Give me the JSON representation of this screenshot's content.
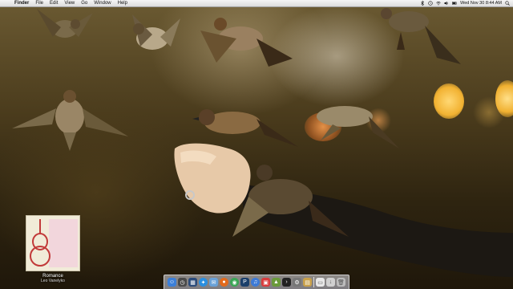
{
  "menubar": {
    "apple_symbol": "",
    "menus": [
      "Finder",
      "File",
      "Edit",
      "View",
      "Go",
      "Window",
      "Help"
    ],
    "clock": "Wed Nov 30  8:44 AM"
  },
  "desktop": {
    "file": {
      "name": "Romance",
      "artist": "Leo Vanelyko"
    }
  },
  "dock": {
    "items": [
      {
        "icon": "finder-icon",
        "color": "#3c7fd8"
      },
      {
        "icon": "dashboard-icon",
        "color": "#4a4a4a"
      },
      {
        "icon": "mission-control-icon",
        "color": "#2b4b7a"
      },
      {
        "icon": "safari-icon",
        "color": "#2a8fe0"
      },
      {
        "icon": "mail-icon",
        "color": "#6aa2d8"
      },
      {
        "icon": "firefox-icon",
        "color": "#e26a1c"
      },
      {
        "icon": "chrome-icon",
        "color": "#3aa655"
      },
      {
        "icon": "photoshop-icon",
        "color": "#1b3f6a"
      },
      {
        "icon": "itunes-icon",
        "color": "#3d7ad6"
      },
      {
        "icon": "ical-icon",
        "color": "#d83c3c"
      },
      {
        "icon": "iphoto-icon",
        "color": "#6a9a3a"
      },
      {
        "icon": "terminal-icon",
        "color": "#222222"
      },
      {
        "icon": "system-preferences-icon",
        "color": "#777777"
      },
      {
        "icon": "preview-icon",
        "color": "#c9a14a"
      }
    ],
    "right_items": [
      {
        "icon": "documents-stack-icon",
        "color": "#e8e8e8"
      },
      {
        "icon": "downloads-stack-icon",
        "color": "#d0d0d0"
      },
      {
        "icon": "trash-icon",
        "color": "#bcbcbc"
      }
    ]
  }
}
